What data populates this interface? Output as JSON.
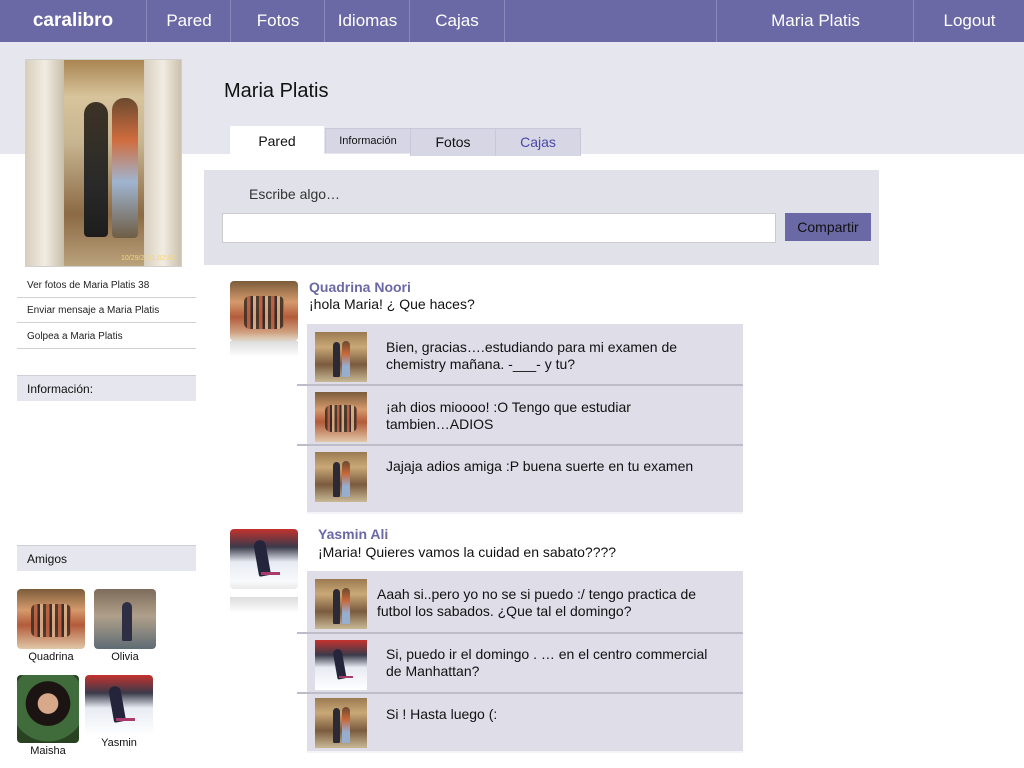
{
  "app": {
    "brand": "caralibro",
    "nav": [
      "Pared",
      "Fotos",
      "Idiomas",
      "Cajas"
    ],
    "user": "Maria Platis",
    "logout": "Logout"
  },
  "profile": {
    "name": "Maria Platis",
    "photo_stamp": "10/29/2011 02:52",
    "tabs": [
      "Pared",
      "Información",
      "Fotos",
      "Cajas"
    ]
  },
  "sidebar": {
    "links": [
      "Ver fotos de Maria Platis 38",
      "Enviar mensaje a Maria Platis",
      "Golpea a Maria Platis"
    ],
    "info_header": "Información:",
    "friends_header": "Amigos",
    "friends": [
      "Quadrina",
      "Olivia",
      "Maisha",
      "Yasmin"
    ]
  },
  "composer": {
    "prompt": "Escribe algo…",
    "input_value": "",
    "button": "Compartir"
  },
  "posts": [
    {
      "author": "Quadrina Noori",
      "text": "¡hola Maria! ¿ Que haces?",
      "replies": [
        "Bien, gracias….estudiando para mi examen de chemistry mañana. -___- y tu?",
        "¡ah dios mioooo! :O Tengo que estudiar tambien…ADIOS",
        "Jajaja adios amiga :P buena suerte en tu examen"
      ]
    },
    {
      "author": "Yasmin Ali",
      "text": "¡Maria! Quieres vamos la cuidad en sabato????",
      "replies": [
        "Aaah si..pero yo no se si puedo :/ tengo practica de futbol los sabados. ¿Que tal el domingo?",
        "Si, puedo ir el domingo . … en el centro commercial de Manhattan?",
        "Si ! Hasta luego (:"
      ]
    }
  ]
}
